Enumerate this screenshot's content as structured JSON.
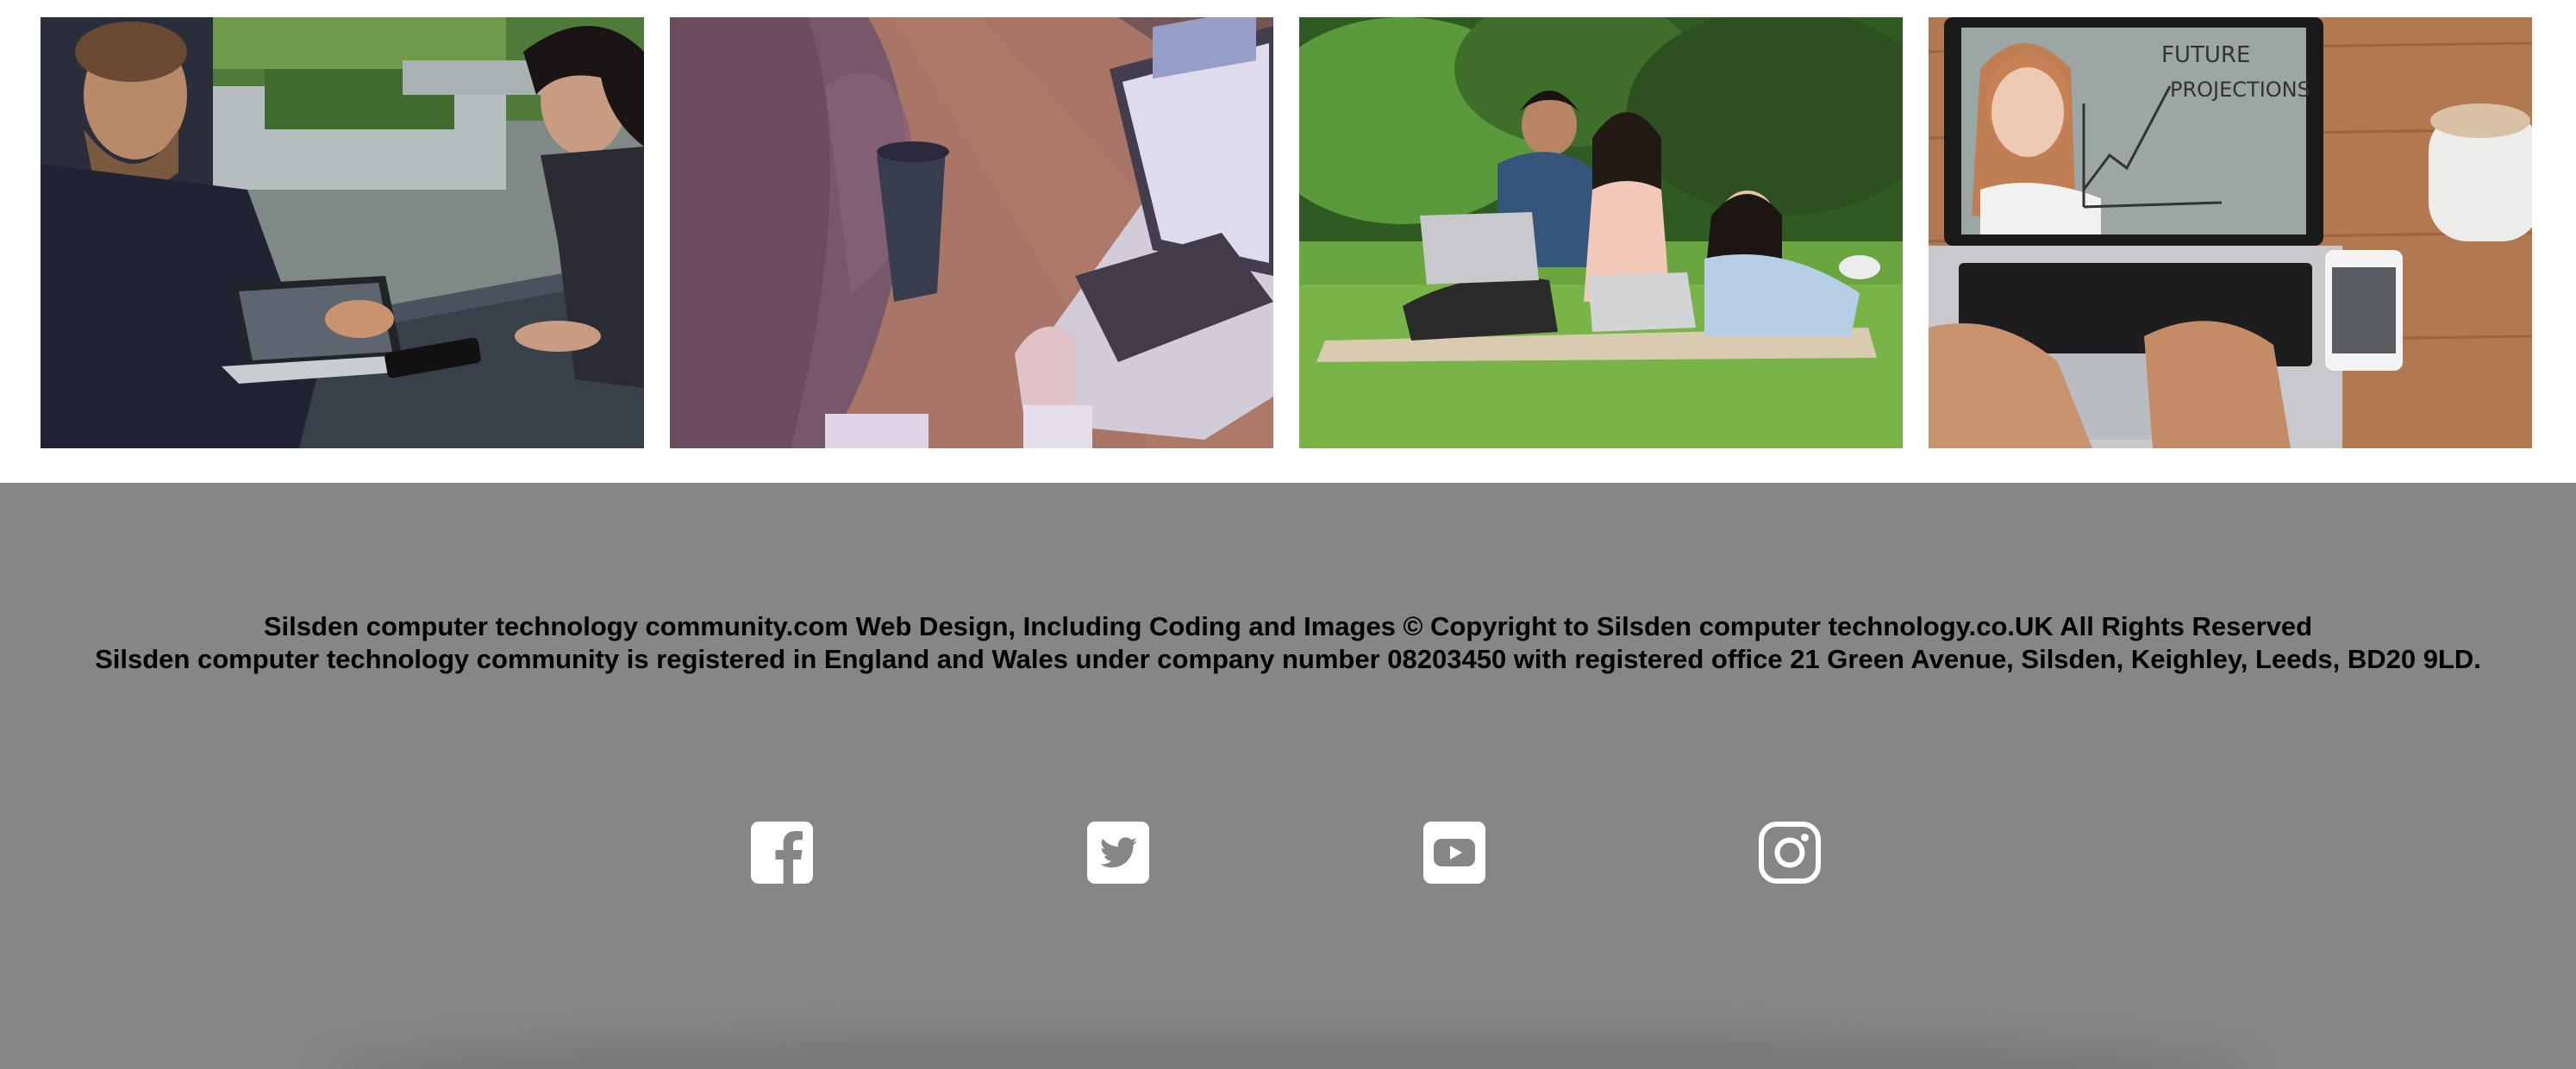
{
  "gallery": {
    "photos": [
      {
        "name": "Business meeting with laptop at outdoor table"
      },
      {
        "name": "Woman with coffee cup using laptop"
      },
      {
        "name": "Three students with laptops on grass"
      },
      {
        "name": "Hands on laptop showing future projections video call"
      }
    ]
  },
  "footer": {
    "copyright_line": "Silsden computer technology community.com Web Design, Including Coding and Images © Copyright to Silsden computer technology.co.UK All Rights Reserved",
    "registration_line": "Silsden computer technology community is registered in England and Wales under company number 08203450 with registered office 21 Green Avenue, Silsden, Keighley, Leeds, BD20 9LD.",
    "social": [
      {
        "icon": "facebook-icon"
      },
      {
        "icon": "twitter-icon"
      },
      {
        "icon": "youtube-icon"
      },
      {
        "icon": "instagram-icon"
      }
    ]
  },
  "colors": {
    "footer_background": "#878586",
    "footer_text": "#000000",
    "icon": "#ffffff"
  }
}
